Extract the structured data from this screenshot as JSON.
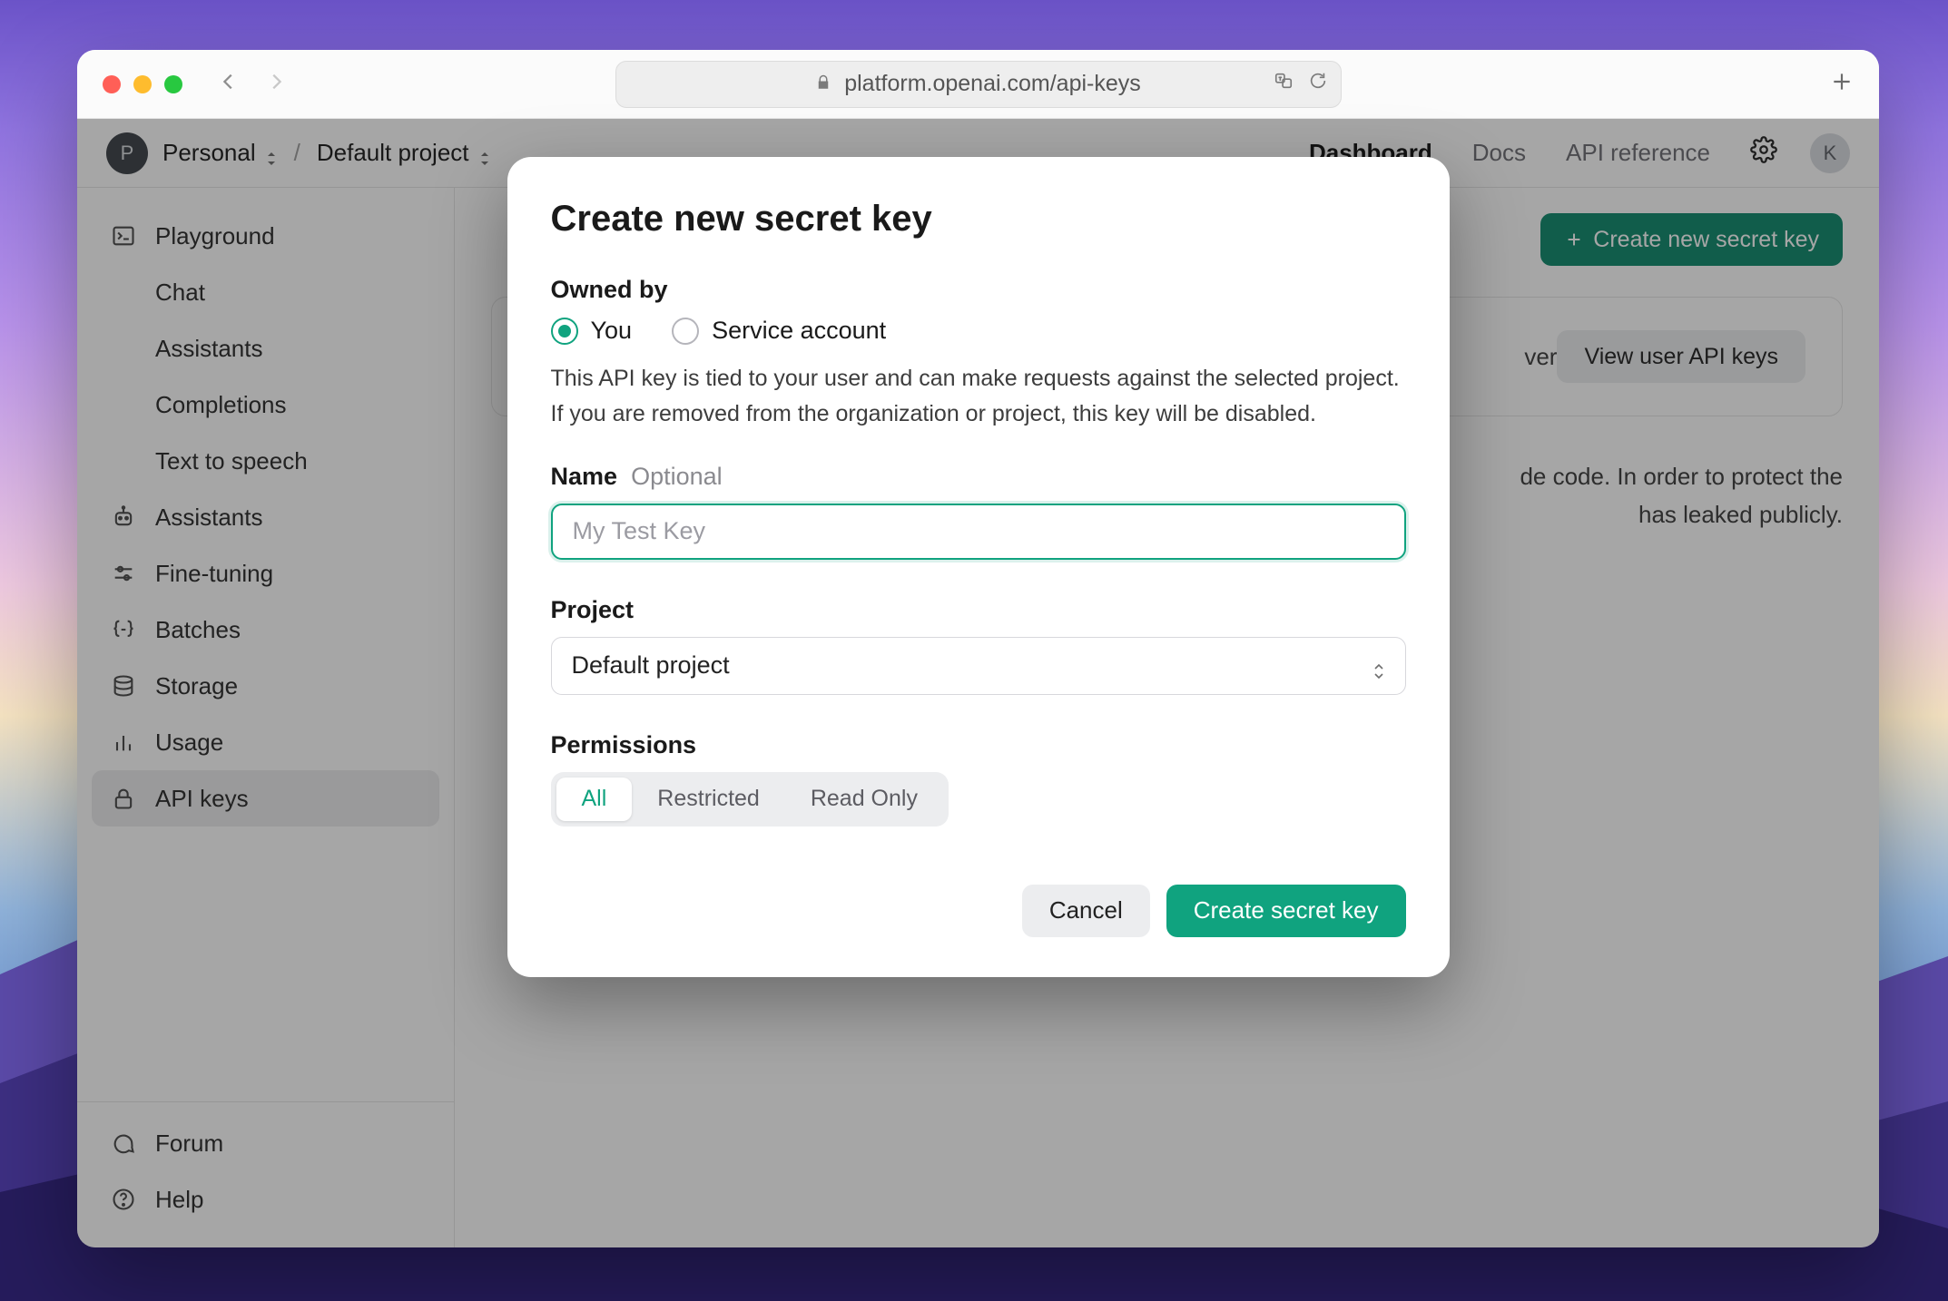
{
  "browser": {
    "url": "platform.openai.com/api-keys"
  },
  "header": {
    "org_initial": "P",
    "org_name": "Personal",
    "project_name": "Default project",
    "nav": {
      "dashboard": "Dashboard",
      "docs": "Docs",
      "api_ref": "API reference"
    },
    "user_initial": "K"
  },
  "sidebar": {
    "playground": "Playground",
    "chat": "Chat",
    "assistants_sub": "Assistants",
    "completions": "Completions",
    "tts": "Text to speech",
    "assistants": "Assistants",
    "fine_tuning": "Fine-tuning",
    "batches": "Batches",
    "storage": "Storage",
    "usage": "Usage",
    "api_keys": "API keys",
    "forum": "Forum",
    "help": "Help"
  },
  "main": {
    "create_button": "Create new secret key",
    "banner_text_1": "ver",
    "view_user_keys": "View user API keys",
    "copy_1": "de code. In order to protect the",
    "copy_2": "has leaked publicly."
  },
  "modal": {
    "title": "Create new secret key",
    "owned_by_label": "Owned by",
    "owner_you": "You",
    "owner_service": "Service account",
    "hint": "This API key is tied to your user and can make requests against the selected project. If you are removed from the organization or project, this key will be disabled.",
    "name_label": "Name",
    "name_optional": "Optional",
    "name_placeholder": "My Test Key",
    "project_label": "Project",
    "project_value": "Default project",
    "permissions_label": "Permissions",
    "perm_all": "All",
    "perm_restricted": "Restricted",
    "perm_readonly": "Read Only",
    "cancel": "Cancel",
    "submit": "Create secret key"
  }
}
